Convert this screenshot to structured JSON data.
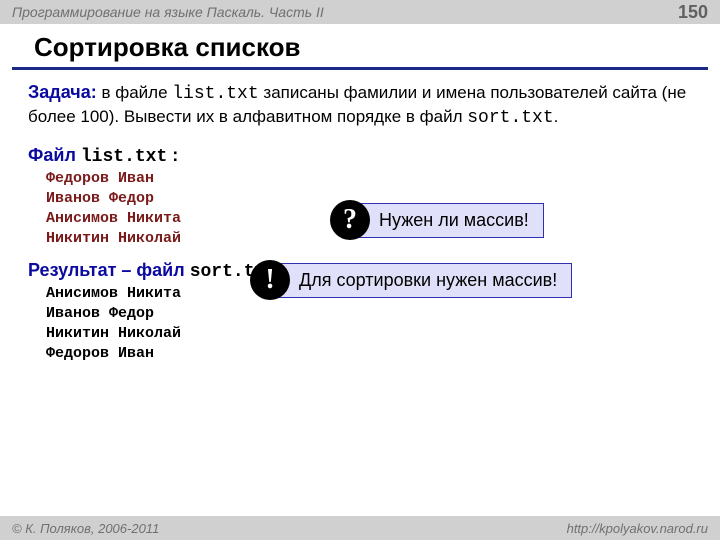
{
  "header": {
    "course": "Программирование на языке Паскаль. Часть II",
    "page": "150"
  },
  "title": "Сортировка списков",
  "task": {
    "label": "Задача:",
    "text_before_file1": " в файле ",
    "file1": "list.txt",
    "text_mid": " записаны фамилии и имена пользователей сайта (не более 100). Вывести их в алфавитном порядке в файл ",
    "file2": "sort.txt",
    "text_after": "."
  },
  "input_section": {
    "label_prefix": "Файл ",
    "filename": "list.txt",
    "label_suffix": " :",
    "lines": [
      "Федоров Иван",
      "Иванов Федор",
      "Анисимов Никита",
      "Никитин Николай"
    ]
  },
  "output_section": {
    "label_prefix": "Результат – файл ",
    "filename": "sort.txt",
    "label_suffix": " :",
    "lines": [
      "Анисимов Никита",
      "Иванов Федор",
      "Никитин Николай",
      "Федоров Иван"
    ]
  },
  "callouts": {
    "question": {
      "icon": "?",
      "text": "Нужен ли массив!"
    },
    "answer": {
      "icon": "!",
      "text": "Для сортировки нужен массив!"
    }
  },
  "footer": {
    "copyright": "© К. Поляков, 2006-2011",
    "url": "http://kpolyakov.narod.ru"
  }
}
